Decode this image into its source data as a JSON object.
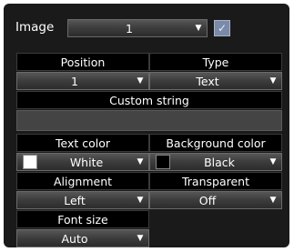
{
  "image": {
    "label": "Image",
    "selected": "1",
    "enabled": true
  },
  "position": {
    "header": "Position",
    "value": "1"
  },
  "type": {
    "header": "Type",
    "value": "Text"
  },
  "custom_string": {
    "header": "Custom string",
    "value": ""
  },
  "text_color": {
    "header": "Text color",
    "value": "White",
    "swatch": "#ffffff"
  },
  "background_color": {
    "header": "Background color",
    "value": "Black",
    "swatch": "#000000"
  },
  "alignment": {
    "header": "Alignment",
    "value": "Left"
  },
  "transparent": {
    "header": "Transparent",
    "value": "Off"
  },
  "font_size": {
    "header": "Font size",
    "value": "Auto"
  },
  "icons": {
    "dropdown": "▼",
    "check": "✓"
  }
}
